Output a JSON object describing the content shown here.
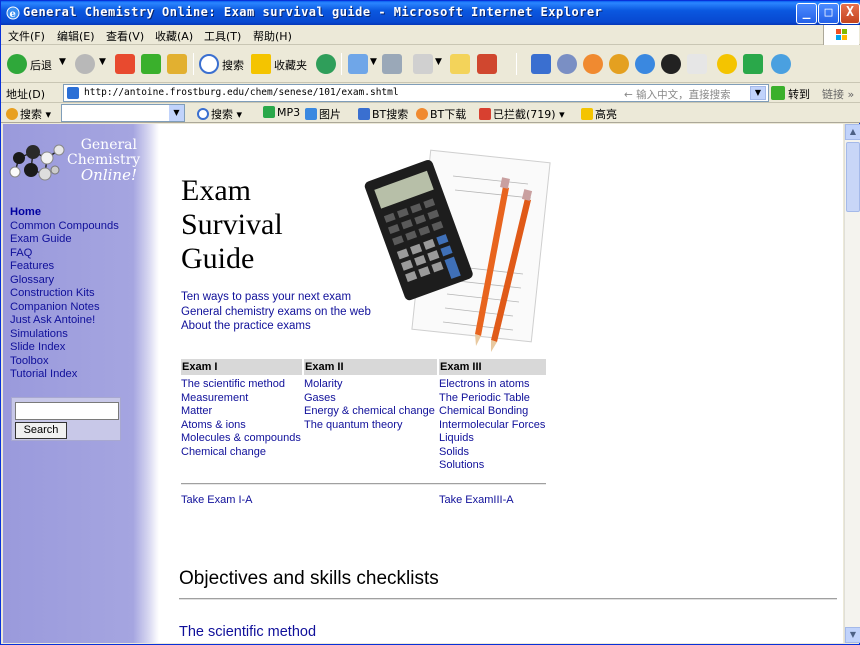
{
  "window": {
    "title": "General Chemistry Online: Exam survival guide - Microsoft Internet Explorer",
    "min_label": "_",
    "max_label": "□",
    "close_label": "X"
  },
  "menu": {
    "items": [
      "文件(F)",
      "编辑(E)",
      "查看(V)",
      "收藏(A)",
      "工具(T)",
      "帮助(H)"
    ]
  },
  "toolbar": {
    "back_label": "后退",
    "search_label": "搜索",
    "favorites_label": "收藏夹"
  },
  "address": {
    "label": "地址(D)",
    "url": "http://antoine.frostburg.edu/chem/senese/101/exam.shtml",
    "hint": "← 输入中文，直接搜索",
    "go_label": "转到",
    "links_label": "链接 »"
  },
  "searchbar": {
    "search_label": "搜索",
    "search2_label": "搜索",
    "mp3_label": "MP3",
    "images_label": "图片",
    "bt_search_label": "BT搜索",
    "bt_download_label": "BT下载",
    "blocked_label": "已拦截(719)",
    "highlight_label": "高亮"
  },
  "sidebar": {
    "logo": {
      "line1": "General",
      "line2": "Chemistry",
      "line3": "Online!"
    },
    "nav": [
      "Home",
      "Common Compounds",
      "Exam Guide",
      "FAQ",
      "Features",
      "Glossary",
      "Construction Kits",
      "Companion Notes",
      "Just Ask Antoine!",
      "Simulations",
      "Slide Index",
      "Toolbox",
      "Tutorial Index"
    ],
    "search_button": "Search"
  },
  "main": {
    "title_lines": [
      "Exam",
      "Survival",
      "Guide"
    ],
    "intro_links": [
      "Ten ways to pass your next exam",
      "General chemistry exams on the web",
      "About the practice exams"
    ],
    "exam_columns": [
      {
        "header": "Exam I",
        "topics": [
          "The scientific method",
          "Measurement",
          "Matter",
          "Atoms & ions",
          "Molecules & compounds",
          "Chemical change"
        ]
      },
      {
        "header": "Exam II",
        "topics": [
          "Molarity",
          "Gases",
          "Energy & chemical change",
          "The quantum theory"
        ]
      },
      {
        "header": "Exam III",
        "topics": [
          "Electrons in atoms",
          "The Periodic Table",
          "Chemical Bonding",
          "Intermolecular Forces",
          "Liquids",
          "Solids",
          "Solutions"
        ]
      }
    ],
    "take_exam_1": "Take Exam I-A",
    "take_exam_3": "Take ExamIII-A",
    "objectives_heading": "Objectives and skills checklists",
    "scientific_method_heading": "The scientific method"
  },
  "colors": {
    "sidebar": "#a5a5e0",
    "link": "#10109a",
    "title_bar": "#0a58e0"
  }
}
